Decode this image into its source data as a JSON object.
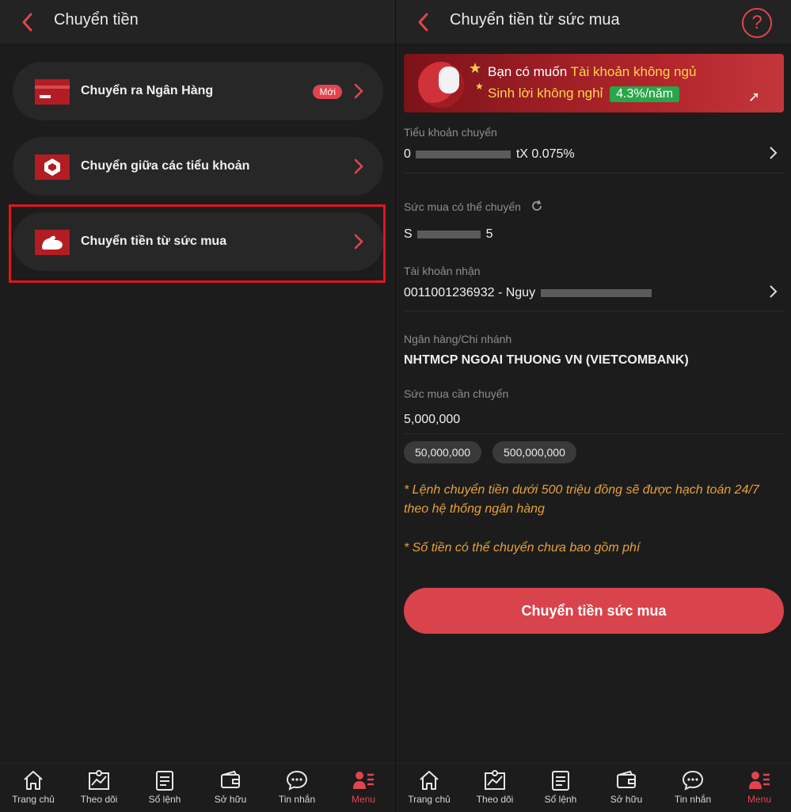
{
  "left": {
    "header": {
      "title": "Chuyển tiền"
    },
    "menu": [
      {
        "label": "Chuyển ra Ngân Hàng",
        "badge": "Mới",
        "icon": "bank-card-icon"
      },
      {
        "label": "Chuyển giữa các tiểu khoản",
        "icon": "sub-account-box-icon"
      },
      {
        "label": "Chuyển tiền từ sức mua",
        "icon": "strength-arm-icon"
      }
    ]
  },
  "right": {
    "header": {
      "title": "Chuyển tiền từ sức mua",
      "help": "?"
    },
    "banner": {
      "line1_prefix": "Bạn có muốn",
      "line1_highlight": "Tài khoản không ngủ",
      "line2": "Sinh lời không nghỉ",
      "rate": "4.3%/năm"
    },
    "source_account": {
      "label": "Tiểu khoản chuyển",
      "value_start": "0",
      "value_end": "tX 0.075%"
    },
    "available": {
      "label": "Sức mua có thể chuyển",
      "value_start": "S",
      "value_end": "5"
    },
    "receiver": {
      "label": "Tài khoản nhận",
      "value": "0011001236932 - Nguy"
    },
    "bank": {
      "label": "Ngân hàng/Chi nhánh",
      "value": "NHTMCP NGOAI THUONG VN (VIETCOMBANK)"
    },
    "amount": {
      "label": "Sức mua cần chuyển",
      "value": "5,000,000"
    },
    "chips": [
      "50,000,000",
      "500,000,000"
    ],
    "notes": [
      "* Lệnh chuyển tiền dưới 500 triệu đồng sẽ được hạch toán 24/7 theo hệ thống ngân hàng",
      "* Số tiền có thể chuyển chưa bao gồm phí"
    ],
    "cta": "Chuyển tiền sức mua"
  },
  "tabs": [
    {
      "label": "Trang chủ",
      "icon": "home-icon"
    },
    {
      "label": "Theo dõi",
      "icon": "chart-watch-icon"
    },
    {
      "label": "Sổ lệnh",
      "icon": "order-book-icon"
    },
    {
      "label": "Sở hữu",
      "icon": "wallet-icon"
    },
    {
      "label": "Tin nhắn",
      "icon": "chat-icon"
    },
    {
      "label": "Menu",
      "icon": "menu-user-icon",
      "active": true
    }
  ],
  "colors": {
    "accent": "#e0454d",
    "background": "#1c1c1c",
    "card": "#272727",
    "note": "#e7a13a",
    "rate_badge": "#29a64a"
  }
}
